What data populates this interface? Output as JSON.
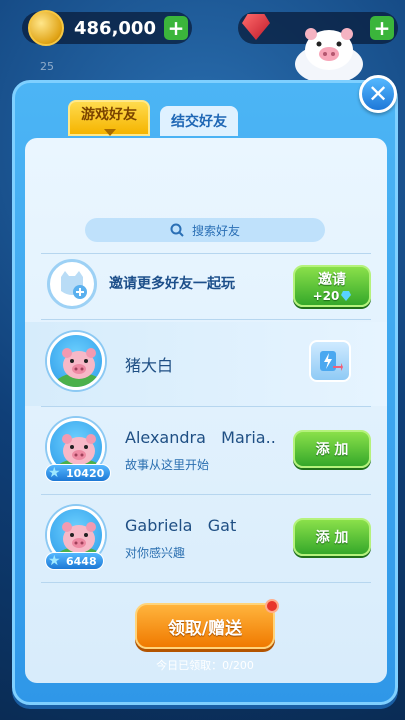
{
  "header": {
    "coins": "486,000",
    "plus": "+",
    "small_stat": "25"
  },
  "tabs": [
    {
      "label": "游戏好友"
    },
    {
      "label": "结交好友"
    }
  ],
  "search": {
    "placeholder": "搜索好友"
  },
  "invite": {
    "text": "邀请更多好友一起玩",
    "button_label": "邀请",
    "button_reward": "+20"
  },
  "friends": [
    {
      "name": "猪大白",
      "subtitle": "",
      "score": ""
    },
    {
      "name": "Alexandra   Maria..",
      "subtitle": "故事从这里开始",
      "score": "10420",
      "action": "添 加"
    },
    {
      "name": "Gabriela   Gat",
      "subtitle": "对你感兴趣",
      "score": "6448",
      "action": "添 加"
    }
  ],
  "footer": {
    "main_button": "领取/赠送",
    "daily_text": "今日已领取：0/200"
  },
  "close_symbol": "✕",
  "colors": {
    "panel_blue": "#2f97e8",
    "tab_active": "#f5b400",
    "green_button": "#35a82a",
    "orange_button": "#f07a00"
  }
}
